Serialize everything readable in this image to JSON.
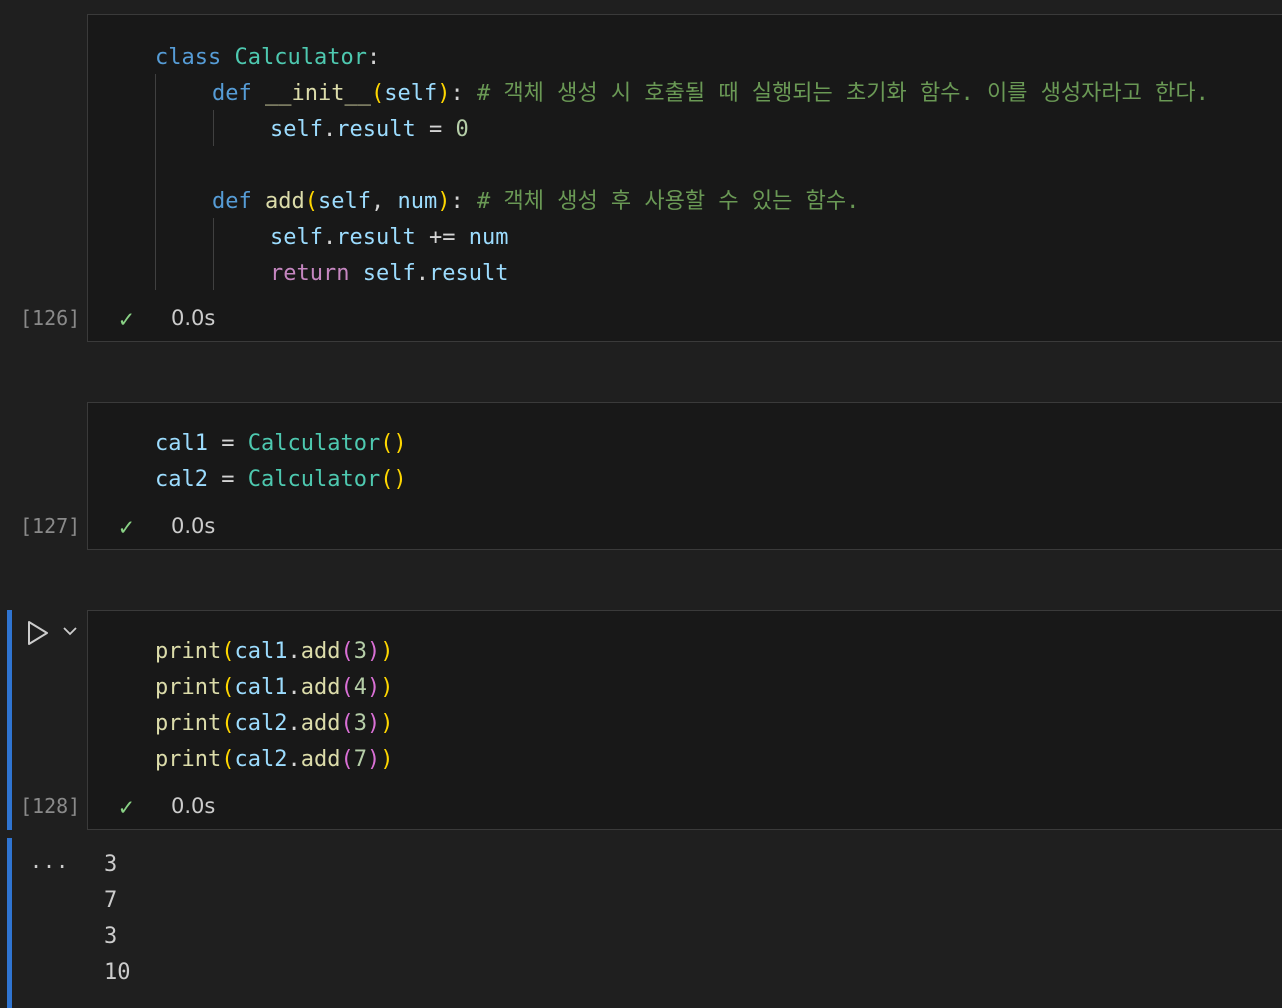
{
  "cells": [
    {
      "execution_count": "[126]",
      "duration": "0.0s",
      "code": {
        "l1": {
          "kw": "class",
          "name": "Calculator",
          "colon": ":"
        },
        "l2": {
          "kw": "def",
          "fn": "__init__",
          "open": "(",
          "param": "self",
          "close": ")",
          "colon": ":",
          "comment": "# 객체 생성 시 호출될 때 실행되는 초기화 함수. 이를 생성자라고 한다."
        },
        "l3": {
          "obj": "self",
          "dot": ".",
          "attr": "result",
          "op": " = ",
          "num": "0"
        },
        "l5": {
          "kw": "def",
          "fn": "add",
          "open": "(",
          "param1": "self",
          "comma": ", ",
          "param2": "num",
          "close": ")",
          "colon": ":",
          "comment": "# 객체 생성 후 사용할 수 있는 함수."
        },
        "l6": {
          "obj": "self",
          "dot": ".",
          "attr": "result",
          "op": " += ",
          "var": "num"
        },
        "l7": {
          "kw": "return",
          "obj": "self",
          "dot": ".",
          "attr": "result"
        }
      }
    },
    {
      "execution_count": "[127]",
      "duration": "0.0s",
      "code": {
        "l1": {
          "var": "cal1",
          "op": " = ",
          "cls": "Calculator",
          "parens": "()"
        },
        "l2": {
          "var": "cal2",
          "op": " = ",
          "cls": "Calculator",
          "parens": "()"
        }
      }
    },
    {
      "execution_count": "[128]",
      "duration": "0.0s",
      "code": {
        "l1": {
          "fn": "print",
          "o1": "(",
          "var": "cal1",
          "dot": ".",
          "method": "add",
          "o2": "(",
          "num": "3",
          "c2": ")",
          "c1": ")"
        },
        "l2": {
          "fn": "print",
          "o1": "(",
          "var": "cal1",
          "dot": ".",
          "method": "add",
          "o2": "(",
          "num": "4",
          "c2": ")",
          "c1": ")"
        },
        "l3": {
          "fn": "print",
          "o1": "(",
          "var": "cal2",
          "dot": ".",
          "method": "add",
          "o2": "(",
          "num": "3",
          "c2": ")",
          "c1": ")"
        },
        "l4": {
          "fn": "print",
          "o1": "(",
          "var": "cal2",
          "dot": ".",
          "method": "add",
          "o2": "(",
          "num": "7",
          "c2": ")",
          "c1": ")"
        }
      },
      "output": [
        "3",
        "7",
        "3",
        "10"
      ],
      "output_ellipsis": "..."
    }
  ],
  "icons": {
    "success": "check-icon",
    "run": "play-icon",
    "menu": "chevron-down-icon"
  },
  "colors": {
    "focus": "#2f74d0",
    "success": "#89d185"
  }
}
